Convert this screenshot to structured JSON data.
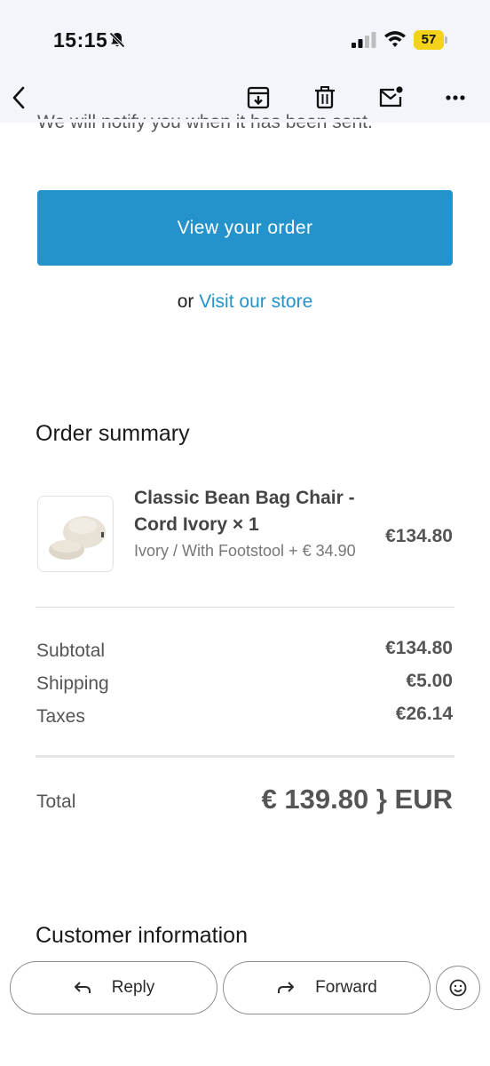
{
  "status_bar": {
    "time": "15:15",
    "battery": "57",
    "icons": [
      "bell-off-icon",
      "signal-icon",
      "wifi-icon",
      "battery-icon"
    ]
  },
  "toolbar": {
    "icons": [
      "back-icon",
      "archive-icon",
      "trash-icon",
      "mark-unread-icon",
      "more-icon"
    ]
  },
  "email": {
    "cut_text": "We will notify you when it has been sent.",
    "view_order_label": "View your order",
    "or_text": "or",
    "visit_store_label": "Visit our store",
    "order_summary_title": "Order summary",
    "product": {
      "name": "Classic Bean Bag Chair - Cord Ivory × 1",
      "variant": "Ivory / With Footstool + € 34.90",
      "price": "€134.80"
    },
    "summary": [
      {
        "label": "Subtotal",
        "value": "€134.80"
      },
      {
        "label": "Shipping",
        "value": "€5.00"
      },
      {
        "label": "Taxes",
        "value": "€26.14"
      }
    ],
    "total_label": "Total",
    "total_value": "€ 139.80 } EUR",
    "customer_info_title": "Customer information"
  },
  "actions": {
    "reply_label": "Reply",
    "forward_label": "Forward"
  },
  "colors": {
    "accent": "#2493cc",
    "battery": "#f5d21a",
    "header_bg": "#f2f5fa"
  }
}
